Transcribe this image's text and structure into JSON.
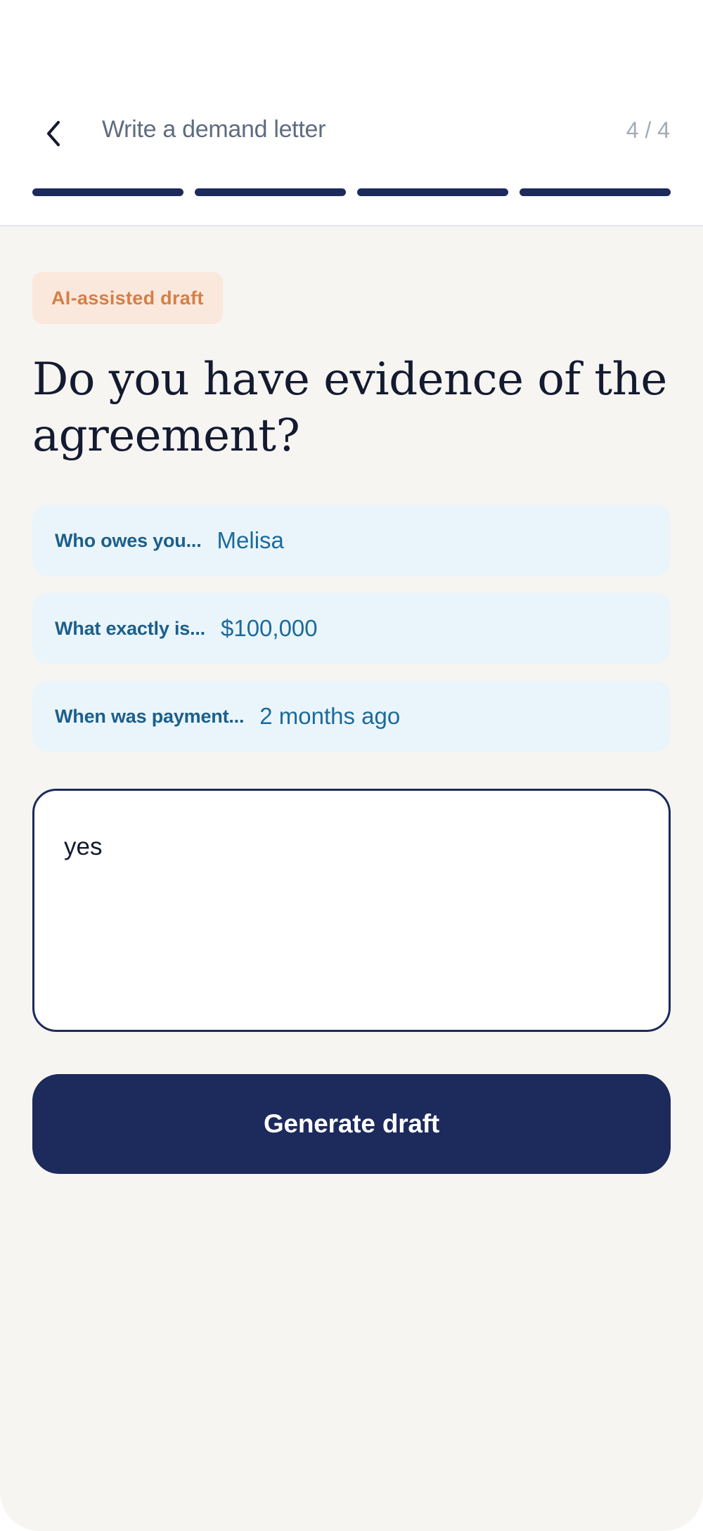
{
  "header": {
    "title": "Write a demand letter",
    "step_counter": "4 / 4",
    "progress": {
      "current_step": 4,
      "total_steps": 4,
      "filled_segments": 4
    },
    "back_icon": "chevron-left-icon",
    "accent_color": "#1c2a5c"
  },
  "badge": {
    "label": "AI-assisted draft",
    "text_color": "#d57f45",
    "background_color": "#fbe8dc"
  },
  "question": "Do you have evidence of the agreement?",
  "previous_answers": [
    {
      "question": "Who owes you...",
      "answer": "Melisa"
    },
    {
      "question": "What exactly is...",
      "answer": "$100,000"
    },
    {
      "question": "When was payment...",
      "answer": "2 months ago"
    }
  ],
  "response": {
    "value": "yes"
  },
  "primary_action": {
    "label": "Generate draft"
  }
}
